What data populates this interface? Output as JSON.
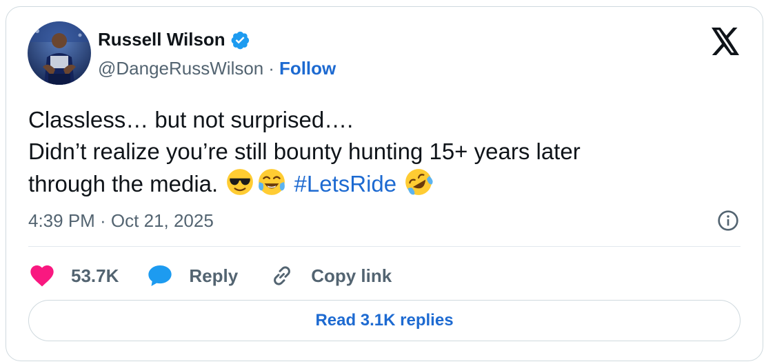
{
  "author": {
    "name": "Russell Wilson",
    "handle": "@DangeRussWilson",
    "separator": "·",
    "follow_label": "Follow",
    "avatar": "player-avatar"
  },
  "tweet": {
    "line1": "Classless… but not surprised….",
    "line2": "Didn’t realize you’re still bounty hunting 15+ years later",
    "line3": "through the media.",
    "hashtag": "#LetsRide",
    "emojis": [
      "cool-sunglasses-emoji",
      "tears-of-joy-emoji",
      "rolling-laughing-emoji"
    ]
  },
  "meta": {
    "timestamp": "4:39 PM · Oct 21, 2025"
  },
  "actions": {
    "like_count": "53.7K",
    "reply_label": "Reply",
    "copy_label": "Copy link"
  },
  "replies_button": "Read 3.1K replies",
  "colors": {
    "accent": "#1d6ad1",
    "heart": "#f91880",
    "reply_bubble": "#1d9bf0",
    "muted": "#536471",
    "border": "#cfd9de"
  }
}
